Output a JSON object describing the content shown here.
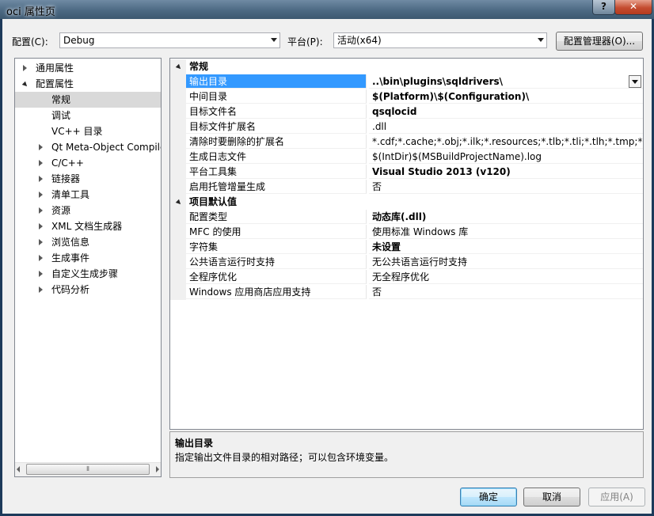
{
  "window": {
    "title": "oci 属性页",
    "help": "?",
    "close": "✕"
  },
  "toolbar": {
    "config_label": "配置(C):",
    "config_value": "Debug",
    "platform_label": "平台(P):",
    "platform_value": "活动(x64)",
    "config_manager": "配置管理器(O)..."
  },
  "tree": [
    {
      "label": "通用属性",
      "level": 0,
      "expander": "closed"
    },
    {
      "label": "配置属性",
      "level": 0,
      "expander": "open"
    },
    {
      "label": "常规",
      "level": 1,
      "expander": "none",
      "selected": true
    },
    {
      "label": "调试",
      "level": 1,
      "expander": "none"
    },
    {
      "label": "VC++ 目录",
      "level": 1,
      "expander": "none"
    },
    {
      "label": "Qt Meta-Object Compile",
      "level": 1,
      "expander": "closed"
    },
    {
      "label": "C/C++",
      "level": 1,
      "expander": "closed"
    },
    {
      "label": "链接器",
      "level": 1,
      "expander": "closed"
    },
    {
      "label": "清单工具",
      "level": 1,
      "expander": "closed"
    },
    {
      "label": "资源",
      "level": 1,
      "expander": "closed"
    },
    {
      "label": "XML 文档生成器",
      "level": 1,
      "expander": "closed"
    },
    {
      "label": "浏览信息",
      "level": 1,
      "expander": "closed"
    },
    {
      "label": "生成事件",
      "level": 1,
      "expander": "closed"
    },
    {
      "label": "自定义生成步骤",
      "level": 1,
      "expander": "closed"
    },
    {
      "label": "代码分析",
      "level": 1,
      "expander": "closed"
    }
  ],
  "tree_scroll": {
    "grip": "⦀"
  },
  "grid": [
    {
      "kind": "category",
      "name": "常规"
    },
    {
      "kind": "prop",
      "name": "输出目录",
      "value": "..\\bin\\plugins\\sqldrivers\\",
      "bold": true,
      "selected": true
    },
    {
      "kind": "prop",
      "name": "中间目录",
      "value": "$(Platform)\\$(Configuration)\\",
      "bold": true
    },
    {
      "kind": "prop",
      "name": "目标文件名",
      "value": "qsqlocid",
      "bold": true
    },
    {
      "kind": "prop",
      "name": "目标文件扩展名",
      "value": ".dll",
      "bold": false
    },
    {
      "kind": "prop",
      "name": "清除时要删除的扩展名",
      "value": "*.cdf;*.cache;*.obj;*.ilk;*.resources;*.tlb;*.tli;*.tlh;*.tmp;*.rsp;*.p",
      "bold": false
    },
    {
      "kind": "prop",
      "name": "生成日志文件",
      "value": "$(IntDir)$(MSBuildProjectName).log",
      "bold": false
    },
    {
      "kind": "prop",
      "name": "平台工具集",
      "value": "Visual Studio 2013 (v120)",
      "bold": true
    },
    {
      "kind": "prop",
      "name": "启用托管增量生成",
      "value": "否",
      "bold": false
    },
    {
      "kind": "category",
      "name": "项目默认值"
    },
    {
      "kind": "prop",
      "name": "配置类型",
      "value": "动态库(.dll)",
      "bold": true
    },
    {
      "kind": "prop",
      "name": "MFC 的使用",
      "value": "使用标准 Windows 库",
      "bold": false
    },
    {
      "kind": "prop",
      "name": "字符集",
      "value": "未设置",
      "bold": true
    },
    {
      "kind": "prop",
      "name": "公共语言运行时支持",
      "value": "无公共语言运行时支持",
      "bold": false
    },
    {
      "kind": "prop",
      "name": "全程序优化",
      "value": "无全程序优化",
      "bold": false
    },
    {
      "kind": "prop",
      "name": "Windows 应用商店应用支持",
      "value": "否",
      "bold": false
    }
  ],
  "description": {
    "title": "输出目录",
    "text": "指定输出文件目录的相对路径；可以包含环境变量。"
  },
  "buttons": {
    "ok": "确定",
    "cancel": "取消",
    "apply": "应用(A)"
  }
}
